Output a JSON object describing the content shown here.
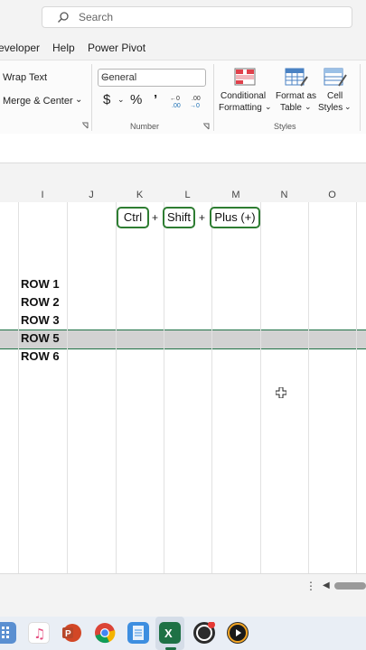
{
  "search": {
    "placeholder": "Search"
  },
  "tabs": {
    "developer": "eveloper",
    "help": "Help",
    "power_pivot": "Power Pivot"
  },
  "ribbon": {
    "wrap_text": "Wrap Text",
    "merge_center": "Merge & Center",
    "number_format": "General",
    "currency_symbol": "$",
    "percent_symbol": "%",
    "comma_symbol": "’",
    "number_group": "Number",
    "cond_fmt_1": "Conditional",
    "cond_fmt_2": "Formatting",
    "fmt_table_1": "Format as",
    "fmt_table_2": "Table",
    "cell_styles_1": "Cell",
    "cell_styles_2": "Styles",
    "styles_group": "Styles"
  },
  "columns": [
    "I",
    "J",
    "K",
    "L",
    "M",
    "N",
    "O"
  ],
  "shortcut": {
    "key1": "Ctrl",
    "plus1": "+",
    "key2": "Shift",
    "plus2": "+",
    "key3": "Plus (+)"
  },
  "rows": [
    "ROW 1",
    "ROW 2",
    "ROW 3",
    "ROW 5",
    "ROW 6"
  ],
  "colors": {
    "excel_green": "#1e7145",
    "key_border": "#2e7d32",
    "selected_row": "#d2d2d2"
  },
  "taskbar_icons": [
    "calculator-icon",
    "music-icon",
    "powerpoint-icon",
    "chrome-icon",
    "notepad-icon",
    "excel-icon",
    "obs-icon",
    "media-player-icon"
  ]
}
